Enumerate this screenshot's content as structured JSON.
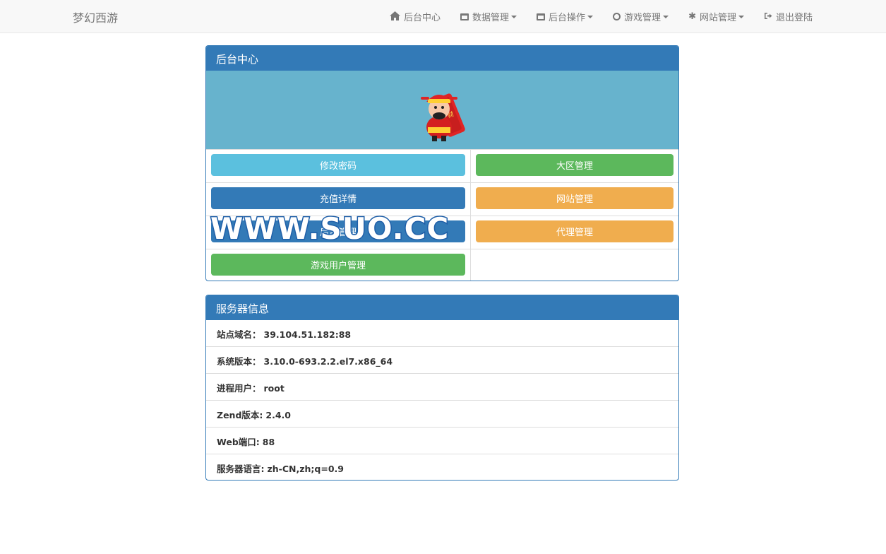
{
  "brand": "梦幻西游",
  "nav": [
    {
      "label": "后台中心",
      "icon": "home-icon",
      "dropdown": false
    },
    {
      "label": "数据管理",
      "icon": "window-icon",
      "dropdown": true
    },
    {
      "label": "后台操作",
      "icon": "window-icon",
      "dropdown": true
    },
    {
      "label": "游戏管理",
      "icon": "clock-icon",
      "dropdown": true
    },
    {
      "label": "网站管理",
      "icon": "gear-icon",
      "dropdown": true
    },
    {
      "label": "退出登陆",
      "icon": "logout-icon",
      "dropdown": false
    }
  ],
  "panel_center": {
    "title": "后台中心",
    "buttons": [
      {
        "label": "修改密码",
        "color": "#5bc0de"
      },
      {
        "label": "大区管理",
        "color": "#5cb85c"
      },
      {
        "label": "充值详情",
        "color": "#337ab7"
      },
      {
        "label": "网站管理",
        "color": "#f0ad4e"
      },
      {
        "label": "后台管理",
        "color": "#337ab7"
      },
      {
        "label": "代理管理",
        "color": "#f0ad4e"
      },
      {
        "label": "游戏用户管理",
        "color": "#5cb85c"
      }
    ]
  },
  "watermark": "WWW.SUO.CC",
  "panel_server": {
    "title": "服务器信息",
    "rows": [
      {
        "label": "站点域名：",
        "value": "39.104.51.182:88"
      },
      {
        "label": "系统版本：",
        "value": "3.10.0-693.2.2.el7.x86_64"
      },
      {
        "label": "进程用户：",
        "value": "root"
      },
      {
        "label": "Zend版本:",
        "value": "2.4.0"
      },
      {
        "label": "Web端口:",
        "value": "88"
      },
      {
        "label": "服务器语言:",
        "value": "zh-CN,zh;q=0.9"
      }
    ]
  },
  "colors": {
    "primary": "#337ab7",
    "banner": "#67b3cd",
    "navbar": "#f8f8f8"
  }
}
